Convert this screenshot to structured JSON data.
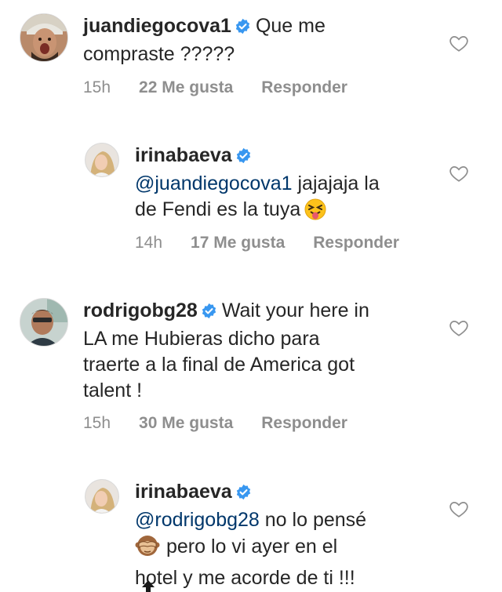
{
  "comments": [
    {
      "username": "juandiegocova1",
      "text": "Que me compraste ?????",
      "text_line1": "Que me",
      "text_line2": "compraste ?????",
      "time": "15h",
      "likes": "22 Me gusta",
      "reply_label": "Responder",
      "verified": true
    },
    {
      "username": "irinabaeva",
      "mention": "@juandiegocova1",
      "text_line1": "jajajaja la",
      "text_line2": "de Fendi es la tuya",
      "emoji": "tongue-out-squint-emoji",
      "time": "14h",
      "likes": "17 Me gusta",
      "reply_label": "Responder",
      "verified": true
    },
    {
      "username": "rodrigobg28",
      "text_line1": "Wait your here in",
      "text_line2": "LA me Hubieras  dicho para",
      "text_line3": "traerte a la final de America got",
      "text_line4": "talent !",
      "time": "15h",
      "likes": "30 Me gusta",
      "reply_label": "Responder",
      "verified": true
    },
    {
      "username": "irinabaeva",
      "mention": "@rodrigobg28",
      "text_line1": "no lo pensé",
      "emoji": "see-no-evil-monkey-emoji",
      "text_line2": "pero lo vi ayer en el",
      "text_line3": "hotel y me acorde de ti !!!",
      "verified": true
    }
  ],
  "colors": {
    "text": "#262626",
    "meta": "#8e8e8e",
    "mention": "#00376b",
    "verified": "#3897f0"
  }
}
